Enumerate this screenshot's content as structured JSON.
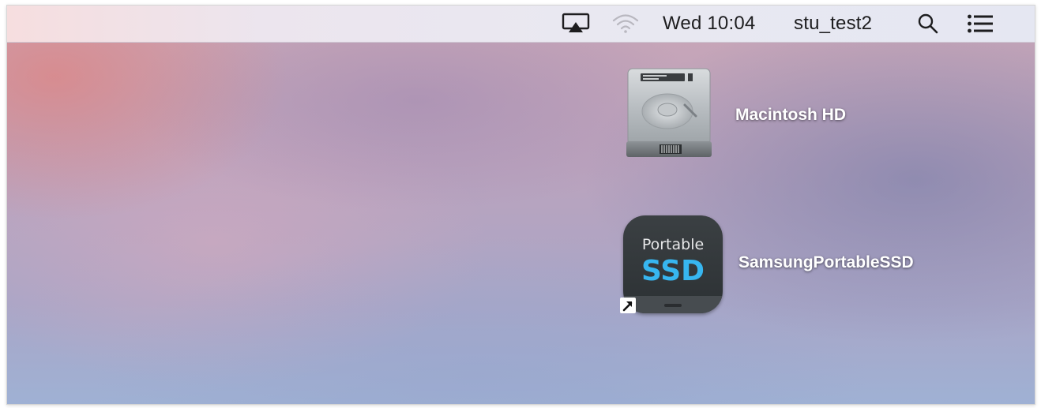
{
  "menubar": {
    "airplay_icon": "airplay-icon",
    "wifi_icon": "wifi-icon",
    "clock": "Wed 10:04",
    "user": "stu_test2",
    "search_icon": "spotlight-search-icon",
    "list_icon": "notification-center-icon"
  },
  "desktop": {
    "items": [
      {
        "label": "Macintosh HD",
        "icon": "hard-drive-icon"
      },
      {
        "label": "SamsungPortableSSD",
        "icon": "portable-ssd-icon",
        "icon_text_top": "Portable",
        "icon_text_main": "SSD"
      }
    ]
  },
  "colors": {
    "ssd_accent": "#37b6f0",
    "ssd_body": "#333739"
  }
}
